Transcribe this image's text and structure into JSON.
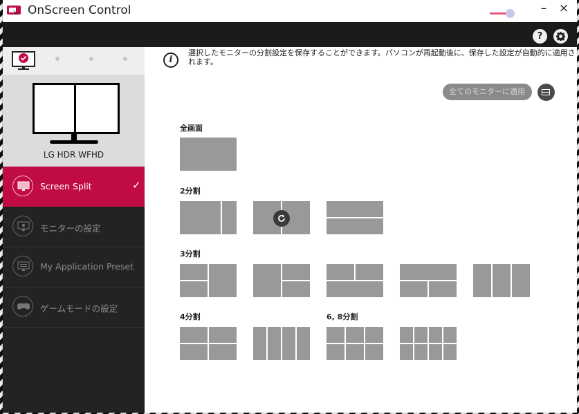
{
  "app": {
    "title": "OnScreen Control",
    "brightness_level": 0.85
  },
  "window_controls": {
    "minimize": "–",
    "close": "×"
  },
  "header": {
    "help": "?",
    "settings_icon": "gear-icon"
  },
  "sidebar": {
    "monitor_name": "LG HDR WFHD",
    "items": [
      {
        "label": "Screen Split",
        "icon": "screen-split-icon",
        "active": true
      },
      {
        "label": "モニターの設定",
        "icon": "monitor-settings-icon",
        "active": false
      },
      {
        "label": "My Application Preset",
        "icon": "app-preset-icon",
        "active": false
      },
      {
        "label": "ゲームモードの設定",
        "icon": "gamepad-icon",
        "active": false
      }
    ]
  },
  "main": {
    "info": "選択したモニターの分割設定を保存することができます。パソコンが再起動後に、保存した設定が自動的に適用されます。",
    "apply_all_label": "全てのモニターに適用",
    "sections": {
      "full": "全画面",
      "two": "2分割",
      "three": "3分割",
      "four": "4分割",
      "six_eight": "6, 8分割"
    }
  },
  "colors": {
    "accent": "#c10b44",
    "tile": "#999999",
    "sidebar": "#232323"
  }
}
